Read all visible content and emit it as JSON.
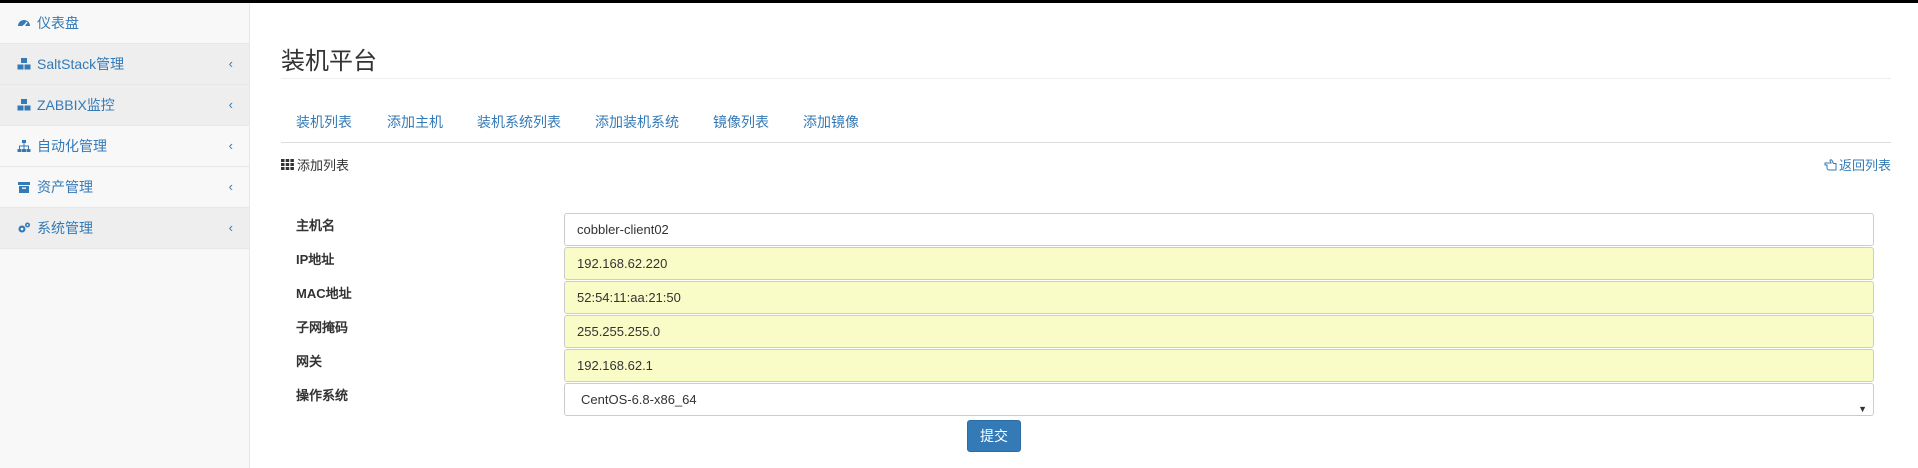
{
  "sidebar": {
    "items": [
      {
        "label": "仪表盘",
        "icon": "dashboard-icon",
        "has_submenu": false
      },
      {
        "label": "SaltStack管理",
        "icon": "cubes-icon",
        "has_submenu": true
      },
      {
        "label": "ZABBIX监控",
        "icon": "cubes-icon",
        "has_submenu": true
      },
      {
        "label": "自动化管理",
        "icon": "sitemap-icon",
        "has_submenu": true
      },
      {
        "label": "资产管理",
        "icon": "archive-icon",
        "has_submenu": true
      },
      {
        "label": "系统管理",
        "icon": "cogs-icon",
        "has_submenu": true
      }
    ],
    "chevron": "‹"
  },
  "page": {
    "title": "装机平台"
  },
  "tabs": [
    "装机列表",
    "添加主机",
    "装机系统列表",
    "添加装机系统",
    "镜像列表",
    "添加镜像"
  ],
  "section": {
    "title": "添加列表",
    "title_icon": "th-icon",
    "back_label": "返回列表",
    "back_icon": "hand-left-icon"
  },
  "form": {
    "hostname": {
      "label": "主机名",
      "value": "cobbler-client02"
    },
    "ip": {
      "label": "IP地址",
      "value": "192.168.62.220"
    },
    "mac": {
      "label": "MAC地址",
      "value": "52:54:11:aa:21:50"
    },
    "netmask": {
      "label": "子网掩码",
      "value": "255.255.255.0"
    },
    "gateway": {
      "label": "网关",
      "value": "192.168.62.1"
    },
    "os": {
      "label": "操作系统",
      "value": "CentOS-6.8-x86_64"
    },
    "submit_label": "提交"
  },
  "colors": {
    "link": "#337ab7",
    "autofill_bg": "#fafcc8",
    "sidebar_bg": "#f8f8f8",
    "highlight_bg": "#eeeeee"
  }
}
